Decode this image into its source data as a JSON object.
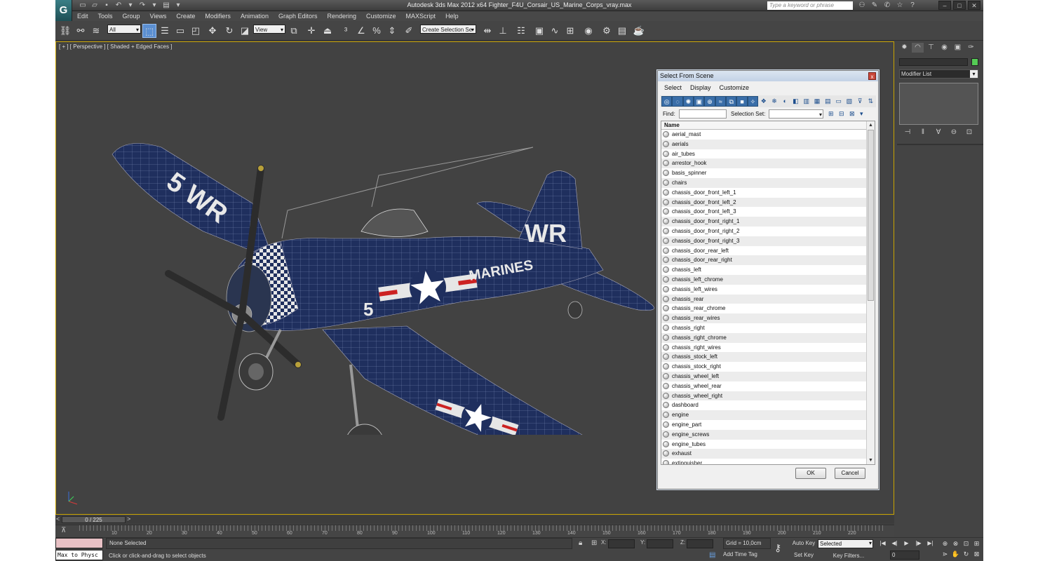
{
  "app": {
    "title": "Autodesk 3ds Max  2012 x64      Fighter_F4U_Corsair_US_Marine_Corps_vray.max",
    "icon_letter": "G",
    "help_search_placeholder": "Type a keyword or phrase"
  },
  "menu": [
    "Edit",
    "Tools",
    "Group",
    "Views",
    "Create",
    "Modifiers",
    "Animation",
    "Graph Editors",
    "Rendering",
    "Customize",
    "MAXScript",
    "Help"
  ],
  "toolbar": {
    "filter_value": "All",
    "refcoord_value": "View",
    "named_selection_placeholder": "Create Selection Se"
  },
  "viewport": {
    "label": "[ + ] [ Perspective ] [ Shaded + Edged Faces ]",
    "fuselage_text": "MARINES",
    "tail_text": "WR",
    "wing_text": "5 WR",
    "number": "5"
  },
  "command_panel": {
    "modifier_list": "Modifier List"
  },
  "dialog": {
    "title": "Select From Scene",
    "close": "x",
    "menu": [
      "Select",
      "Display",
      "Customize"
    ],
    "find_label": "Find:",
    "selection_set_label": "Selection Set:",
    "column_name": "Name",
    "ok": "OK",
    "cancel": "Cancel",
    "objects": [
      "aerial_mast",
      "aerials",
      "air_tubes",
      "arrestor_hook",
      "basis_spinner",
      "chairs",
      "chassis_door_front_left_1",
      "chassis_door_front_left_2",
      "chassis_door_front_left_3",
      "chassis_door_front_right_1",
      "chassis_door_front_right_2",
      "chassis_door_front_right_3",
      "chassis_door_rear_left",
      "chassis_door_rear_right",
      "chassis_left",
      "chassis_left_chrome",
      "chassis_left_wires",
      "chassis_rear",
      "chassis_rear_chrome",
      "chassis_rear_wires",
      "chassis_right",
      "chassis_right_chrome",
      "chassis_right_wires",
      "chassis_stock_left",
      "chassis_stock_right",
      "chassis_wheel_left",
      "chassis_wheel_rear",
      "chassis_wheel_right",
      "dashboard",
      "engine",
      "engine_part",
      "engine_screws",
      "engine_tubes",
      "exhaust",
      "extinguisher"
    ]
  },
  "timeline": {
    "slider": "0 / 225",
    "ticks": [
      "10",
      "20",
      "30",
      "40",
      "50",
      "60",
      "70",
      "80",
      "90",
      "100",
      "110",
      "120",
      "130",
      "140",
      "150",
      "160",
      "170",
      "180",
      "190",
      "200",
      "210",
      "220"
    ]
  },
  "status": {
    "maxscript": "Max to Physc",
    "selection": "None Selected",
    "prompt": "Click or click-and-drag to select objects",
    "x_label": "X:",
    "y_label": "Y:",
    "z_label": "Z:",
    "grid": "Grid = 10,0cm",
    "add_time_tag": "Add Time Tag",
    "auto_key": "Auto Key",
    "set_key": "Set Key",
    "selected": "Selected",
    "key_filters": "Key Filters...",
    "frame": "0"
  },
  "colors": {
    "viewport_bg": "#424242",
    "aircraft_blue": "#1f2f5e",
    "active_viewport_border": "#c8a300",
    "active_tool": "#5b8fd1"
  }
}
